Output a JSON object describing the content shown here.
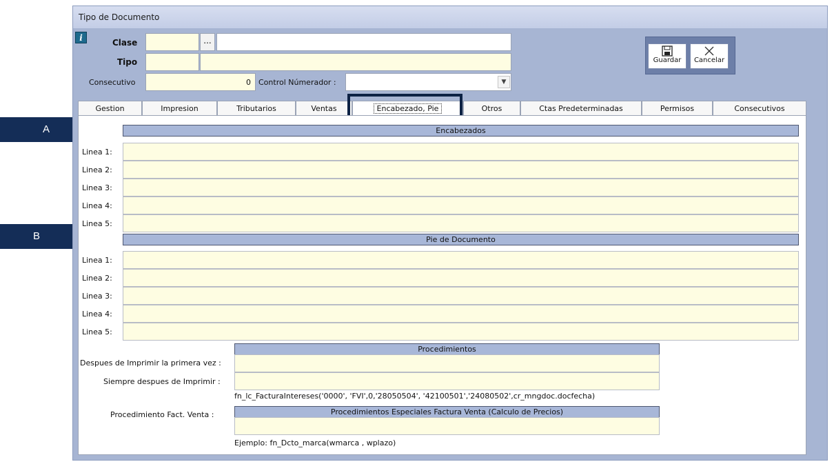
{
  "window": {
    "title": "Tipo de Documento"
  },
  "header": {
    "clase_label": "Clase",
    "ellipsis": "...",
    "tipo_label": "Tipo",
    "consecutivo_label": "Consecutivo",
    "consecutivo_value": "0",
    "control_numerador_label": "Control Númerador :"
  },
  "toolbar": {
    "save_label": "Guardar",
    "cancel_label": "Cancelar"
  },
  "tabs": [
    {
      "label": "Gestion"
    },
    {
      "label": "Impresion"
    },
    {
      "label": "Tributarios"
    },
    {
      "label": "Ventas"
    },
    {
      "label": "Encabezado, Pie"
    },
    {
      "label": "Otros"
    },
    {
      "label": "Ctas Predeterminadas"
    },
    {
      "label": "Permisos"
    },
    {
      "label": "Consecutivos"
    }
  ],
  "active_tab": "Encabezado, Pie",
  "encabezados": {
    "title": "Encabezados",
    "lines": [
      "Linea 1:",
      "Linea 2:",
      "Linea 3:",
      "Linea 4:",
      "Linea 5:"
    ]
  },
  "pie": {
    "title": "Pie de Documento",
    "lines": [
      "Linea 1:",
      "Linea 2:",
      "Linea 3:",
      "Linea 4:",
      "Linea 5:"
    ]
  },
  "procedimientos": {
    "title": "Procedimientos",
    "first_print_label": "Despues de Imprimir la primera vez :",
    "always_after_label": "Siempre despues de Imprimir :",
    "hint": "fn_lc_FacturaIntereses('0000', 'FVI',0,'28050504', '42100501','24080502',cr_mngdoc.docfecha)"
  },
  "especiales": {
    "label": "Procedimiento  Fact. Venta :",
    "title": "Procedimientos Especiales Factura Venta  (Calculo de Precios)",
    "example": "Ejemplo:  fn_Dcto_marca(wmarca , wplazo)"
  },
  "callouts": {
    "a": "A",
    "b": "B"
  },
  "colors": {
    "window_bg": "#a7b5d3",
    "field_bg": "#fefde2",
    "section_header": "#a8b7d8",
    "callout": "#142d57"
  }
}
